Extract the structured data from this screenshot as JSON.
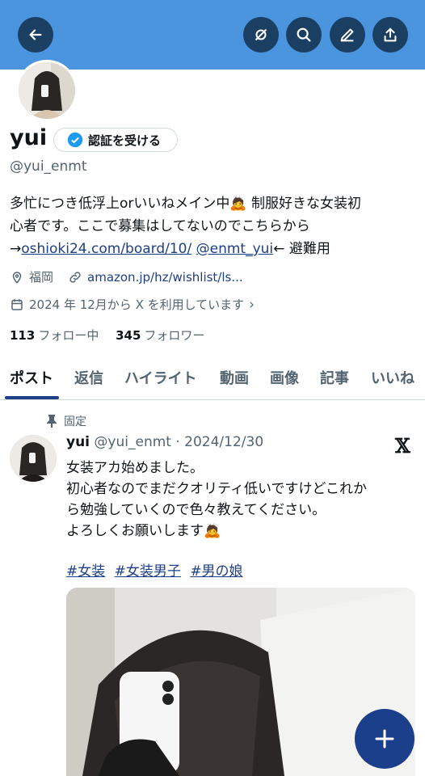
{
  "header": {
    "icons": [
      "back-arrow-icon",
      "mute-icon",
      "search-icon",
      "edit-icon",
      "share-icon"
    ]
  },
  "profile": {
    "name": "yui",
    "verify_label": "認証を受ける",
    "handle": "@yui_enmt",
    "bio_line1": "多忙につき低浮上orいいねメイン中",
    "bio_line1b": " 制服好きな女装初",
    "bio_line2": "心者です。ここで募集はしてないのでこちらから",
    "bio_arrow": "→",
    "bio_link1": "oshioki24.com/board/10/",
    "bio_link2": "@enmt_yui",
    "bio_tail": "← 避難用",
    "location": "福岡",
    "website": "amazon.jp/hz/wishlist/ls...",
    "joined": "2024 年 12月から X を利用しています",
    "following_count": "113",
    "following_label": "フォロー中",
    "followers_count": "345",
    "followers_label": "フォロワー"
  },
  "tabs": [
    "ポスト",
    "返信",
    "ハイライト",
    "動画",
    "画像",
    "記事",
    "いいね"
  ],
  "post": {
    "pinned_label": "固定",
    "author": "yui",
    "handle_date": "@yui_enmt · 2024/12/30",
    "text": "女装アカ始めました。\n初心者なのでまだクオリティ低いですけどこれか\nら勉強していくので色々教えてください。\nよろしくお願いします",
    "hashtags": [
      "#女装",
      "#女装男子",
      "#男の娘"
    ],
    "x_logo": "𝕏"
  },
  "fab_label": "+",
  "colors": {
    "banner": "#4a95de",
    "button": "#1b3f63",
    "accent": "#1d3f86",
    "fab": "#1c3f8c"
  }
}
